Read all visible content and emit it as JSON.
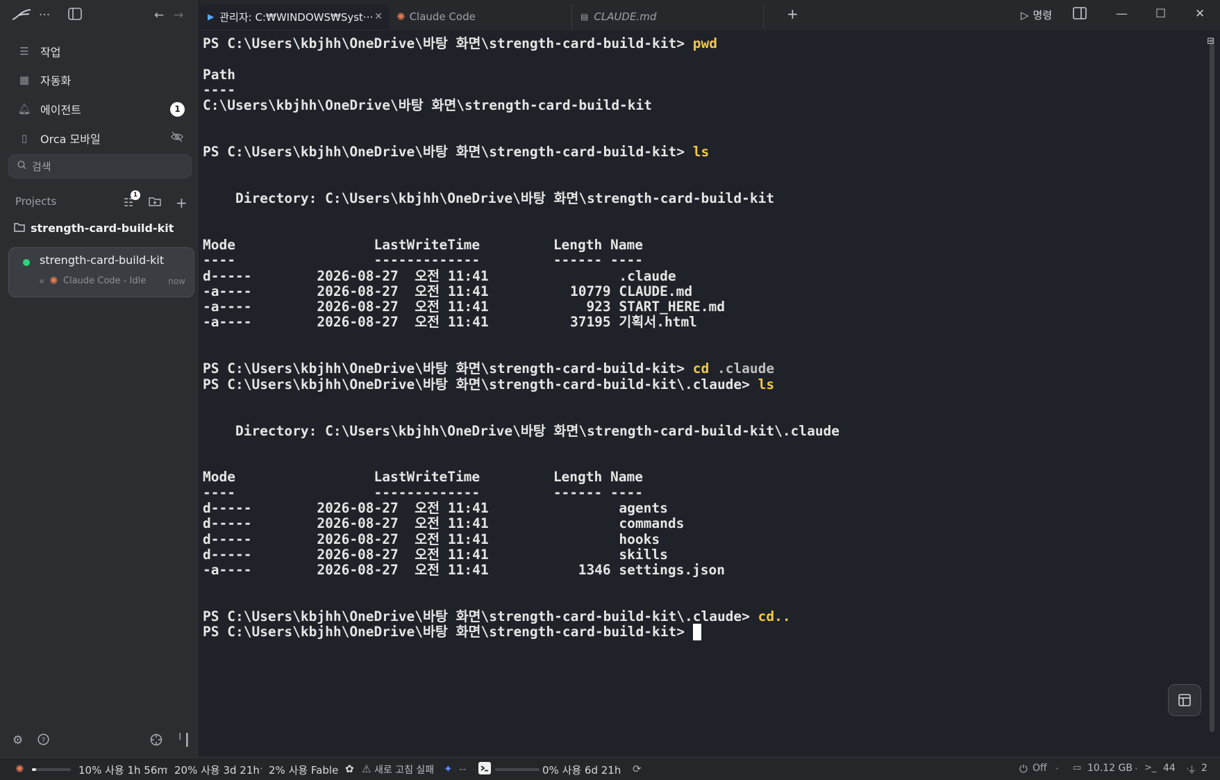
{
  "sidebar": {
    "nav": [
      {
        "icon": "list-icon",
        "label": "작업"
      },
      {
        "icon": "calendar-clock-icon",
        "label": "자동화"
      },
      {
        "icon": "bell-icon",
        "label": "에이전트",
        "badge": "1"
      },
      {
        "icon": "phone-icon",
        "label": "Orca 모바일"
      }
    ],
    "search_placeholder": "검색",
    "projects_label": "Projects",
    "filter_badge": "1",
    "project_folder": "strength-card-build-kit",
    "session": {
      "name": "strength-card-build-kit",
      "sub": "Claude Code - Idle",
      "time": "now",
      "status_color": "#2dd37a"
    }
  },
  "tabs": [
    {
      "label": "관리자: C:₩WINDOWS₩Syst···",
      "icon": "powershell-icon",
      "active": true
    },
    {
      "label": "Claude Code",
      "icon": "claude-icon"
    },
    {
      "label": "CLAUDE.md",
      "icon": "file-icon"
    }
  ],
  "header": {
    "command_label": "명령"
  },
  "terminal": {
    "lines": [
      {
        "prompt": "PS C:\\Users\\kbjhh\\OneDrive\\바탕 화면\\strength-card-build-kit> ",
        "cmd": "pwd"
      },
      {
        "text": ""
      },
      {
        "text": "Path"
      },
      {
        "text": "----"
      },
      {
        "text": "C:\\Users\\kbjhh\\OneDrive\\바탕 화면\\strength-card-build-kit"
      },
      {
        "text": ""
      },
      {
        "text": ""
      },
      {
        "prompt": "PS C:\\Users\\kbjhh\\OneDrive\\바탕 화면\\strength-card-build-kit> ",
        "cmd": "ls"
      },
      {
        "text": ""
      },
      {
        "text": ""
      },
      {
        "text": "    Directory: C:\\Users\\kbjhh\\OneDrive\\바탕 화면\\strength-card-build-kit"
      },
      {
        "text": ""
      },
      {
        "text": ""
      },
      {
        "text": "Mode                 LastWriteTime         Length Name"
      },
      {
        "text": "----                 -------------         ------ ----"
      },
      {
        "text": "d-----        2026-08-27  오전 11:41                .claude"
      },
      {
        "text": "-a----        2026-08-27  오전 11:41          10779 CLAUDE.md"
      },
      {
        "text": "-a----        2026-08-27  오전 11:41            923 START_HERE.md"
      },
      {
        "text": "-a----        2026-08-27  오전 11:41          37195 기획서.html"
      },
      {
        "text": ""
      },
      {
        "text": ""
      },
      {
        "prompt": "PS C:\\Users\\kbjhh\\OneDrive\\바탕 화면\\strength-card-build-kit> ",
        "cmd": "cd",
        "arg": " .claude"
      },
      {
        "prompt": "PS C:\\Users\\kbjhh\\OneDrive\\바탕 화면\\strength-card-build-kit\\.claude> ",
        "cmd": "ls"
      },
      {
        "text": ""
      },
      {
        "text": ""
      },
      {
        "text": "    Directory: C:\\Users\\kbjhh\\OneDrive\\바탕 화면\\strength-card-build-kit\\.claude"
      },
      {
        "text": ""
      },
      {
        "text": ""
      },
      {
        "text": "Mode                 LastWriteTime         Length Name"
      },
      {
        "text": "----                 -------------         ------ ----"
      },
      {
        "text": "d-----        2026-08-27  오전 11:41                agents"
      },
      {
        "text": "d-----        2026-08-27  오전 11:41                commands"
      },
      {
        "text": "d-----        2026-08-27  오전 11:41                hooks"
      },
      {
        "text": "d-----        2026-08-27  오전 11:41                skills"
      },
      {
        "text": "-a----        2026-08-27  오전 11:41           1346 settings.json"
      },
      {
        "text": ""
      },
      {
        "text": ""
      },
      {
        "prompt": "PS C:\\Users\\kbjhh\\OneDrive\\바탕 화면\\strength-card-build-kit\\.claude> ",
        "cmd": "cd.."
      },
      {
        "prompt": "PS C:\\Users\\kbjhh\\OneDrive\\바탕 화면\\strength-card-build-kit> ",
        "cursor": true
      }
    ]
  },
  "statusbar": {
    "usage_5h": {
      "text": "10% 사용 1h 56m",
      "fraction": 0.1
    },
    "usage_week": "20% 사용 3d 21h",
    "usage_fable": "2% 사용 Fable",
    "refresh_failed": "새로 고침 실패",
    "gemini_status": "--",
    "usage_other": {
      "text": "0% 사용 6d 21h",
      "fraction": 0.0
    },
    "toggle": "Off",
    "memory": "10.12 GB",
    "terminals": "44",
    "ports": "2"
  }
}
